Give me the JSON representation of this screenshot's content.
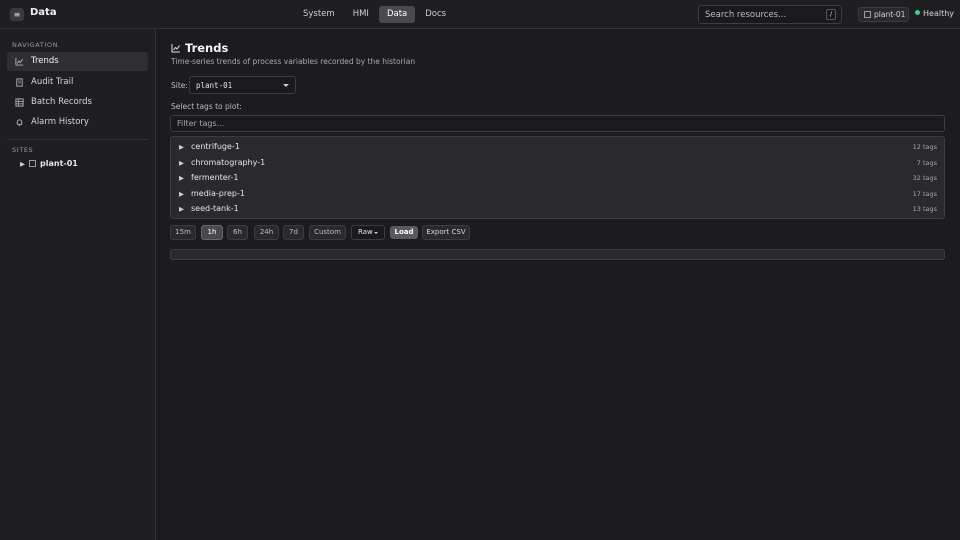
{
  "header": {
    "menu_glyph": "≡",
    "app_title": "Data",
    "tabs": [
      {
        "label": "System",
        "active": false
      },
      {
        "label": "HMI",
        "active": false
      },
      {
        "label": "Data",
        "active": true
      },
      {
        "label": "Docs",
        "active": false
      }
    ],
    "search_placeholder": "Search resources...",
    "search_shortcut": "/",
    "site_chip": "plant-01",
    "health": "Healthy",
    "health_color": "#39d38a"
  },
  "sidebar": {
    "navigation_label": "NAVIGATION",
    "items": [
      {
        "label": "Trends",
        "icon": "chart-line-icon",
        "active": true
      },
      {
        "label": "Audit Trail",
        "icon": "document-icon",
        "active": false
      },
      {
        "label": "Batch Records",
        "icon": "grid-icon",
        "active": false
      },
      {
        "label": "Alarm History",
        "icon": "bell-icon",
        "active": false
      }
    ],
    "sites_label": "SITES",
    "sites": [
      {
        "name": "plant-01",
        "icon": "building-icon"
      }
    ]
  },
  "main": {
    "title": "Trends",
    "title_icon": "chart-line-icon",
    "subtitle": "Time-series trends of process variables recorded by the historian",
    "site_label": "Site:",
    "site_value": "plant-01",
    "select_tags_label": "Select tags to plot:",
    "filter_placeholder": "Filter tags...",
    "tag_groups": [
      {
        "name": "centrifuge-1",
        "count": "12 tags"
      },
      {
        "name": "chromatography-1",
        "count": "7 tags"
      },
      {
        "name": "fermenter-1",
        "count": "32 tags"
      },
      {
        "name": "media-prep-1",
        "count": "17 tags"
      },
      {
        "name": "seed-tank-1",
        "count": "13 tags"
      }
    ],
    "ranges": [
      {
        "label": "15m",
        "active": false
      },
      {
        "label": "1h",
        "active": true
      },
      {
        "label": "6h",
        "active": false
      },
      {
        "label": "24h",
        "active": false
      },
      {
        "label": "7d",
        "active": false
      },
      {
        "label": "Custom",
        "active": false
      }
    ],
    "mode": "Raw",
    "load_label": "Load",
    "export_label": "Export CSV"
  }
}
